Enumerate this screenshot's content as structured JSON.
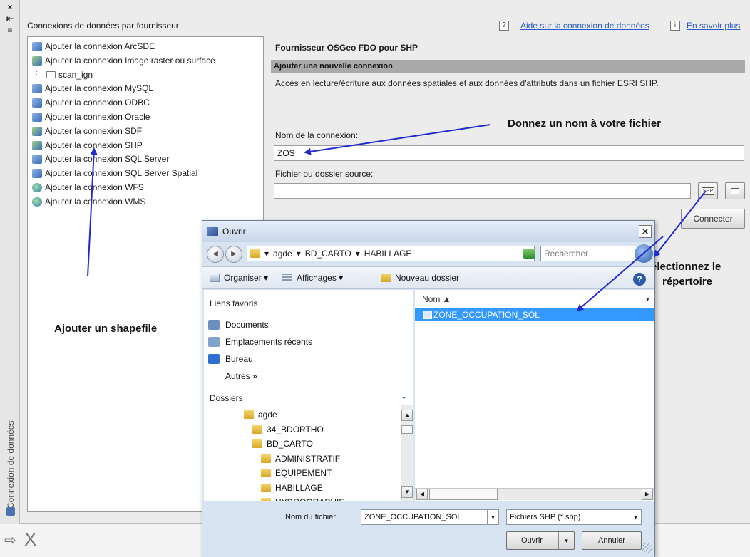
{
  "palette": {
    "strip_close": "×",
    "strip_pin": "⇤",
    "strip_menu": "≡",
    "strip_title": "Connexion de données",
    "left_title": "Connexions de données par fournisseur",
    "tree_items": [
      {
        "label": "Ajouter la connexion ArcSDE",
        "icon": "blue"
      },
      {
        "label": "Ajouter la connexion Image raster ou surface",
        "icon": "raster"
      },
      {
        "label": "scan_ign",
        "icon": "folder"
      },
      {
        "label": "Ajouter la connexion MySQL",
        "icon": "blue"
      },
      {
        "label": "Ajouter la connexion ODBC",
        "icon": "blue"
      },
      {
        "label": "Ajouter la connexion Oracle",
        "icon": "blue"
      },
      {
        "label": "Ajouter la connexion SDF",
        "icon": "raster"
      },
      {
        "label": "Ajouter la connexion SHP",
        "icon": "raster"
      },
      {
        "label": "Ajouter la connexion SQL Server",
        "icon": "blue"
      },
      {
        "label": "Ajouter la connexion SQL Server Spatial",
        "icon": "blue"
      },
      {
        "label": "Ajouter la connexion WFS",
        "icon": "globe"
      },
      {
        "label": "Ajouter la connexion WMS",
        "icon": "globe"
      }
    ]
  },
  "right": {
    "help_icon": "?",
    "help_link": "Aide sur la connexion de données",
    "info_icon": "i",
    "info_link": "En savoir plus",
    "provider_title": "Fournisseur OSGeo FDO pour SHP",
    "section_bar": "Ajouter une nouvelle connexion",
    "description": "Accès en lecture/écriture aux données spatiales et aux données d'attributs dans un fichier ESRI SHP.",
    "name_label": "Nom de la connexion:",
    "name_value": "ZOS",
    "source_label": "Fichier ou dossier source:",
    "source_value": "",
    "shp_button": "SHP",
    "connect_button": "Connecter"
  },
  "annotations": {
    "name_file": "Donnez un nom à votre fichier",
    "add_shapefile": "Ajouter un shapefile",
    "select_dir_1": "Sélectionnez le",
    "select_dir_2": "répertoire"
  },
  "cmdline": {
    "arrow": "⇨",
    "close": "X"
  },
  "dialog": {
    "title": "Ouvrir",
    "close": "×",
    "back": "◀",
    "forward": "▶",
    "breadcrumb": [
      "agde",
      "BD_CARTO",
      "HABILLAGE"
    ],
    "crumb_sep": "▾",
    "search_placeholder": "Rechercher",
    "toolbar": {
      "organize": "Organiser ▾",
      "views": "Affichages ▾",
      "new_folder": "Nouveau dossier"
    },
    "help": "?",
    "favorites_label": "Liens favoris",
    "favorites": [
      {
        "label": "Documents",
        "color": "#6c8fbf"
      },
      {
        "label": "Emplacements récents",
        "color": "#7fa3c9"
      },
      {
        "label": "Bureau",
        "color": "#2f6fd0"
      }
    ],
    "more_label": "Autres »",
    "folders_label": "Dossiers",
    "folders_chev": "⌄",
    "folders": [
      {
        "label": "agde",
        "indent": 56
      },
      {
        "label": "34_BDORTHO",
        "indent": 68
      },
      {
        "label": "BD_CARTO",
        "indent": 68
      },
      {
        "label": "ADMINISTRATIF",
        "indent": 80
      },
      {
        "label": "EQUIPEMENT",
        "indent": 80
      },
      {
        "label": "HABILLAGE",
        "indent": 80
      },
      {
        "label": "HYDROGRAPHIE",
        "indent": 80
      }
    ],
    "column_name": "Nom ▲",
    "column_drop": "▾",
    "files": [
      "ZONE_OCCUPATION_SOL"
    ],
    "scroll_up": "▲",
    "scroll_down": "▼",
    "scroll_left": "◀",
    "scroll_right": "▶",
    "filename_label": "Nom du fichier :",
    "filename_value": "ZONE_OCCUPATION_SOL",
    "filetype_value": "Fichiers SHP (*.shp)",
    "dropdown_arrow": "▾",
    "open_button": "Ouvrir",
    "cancel_button": "Annuler"
  }
}
